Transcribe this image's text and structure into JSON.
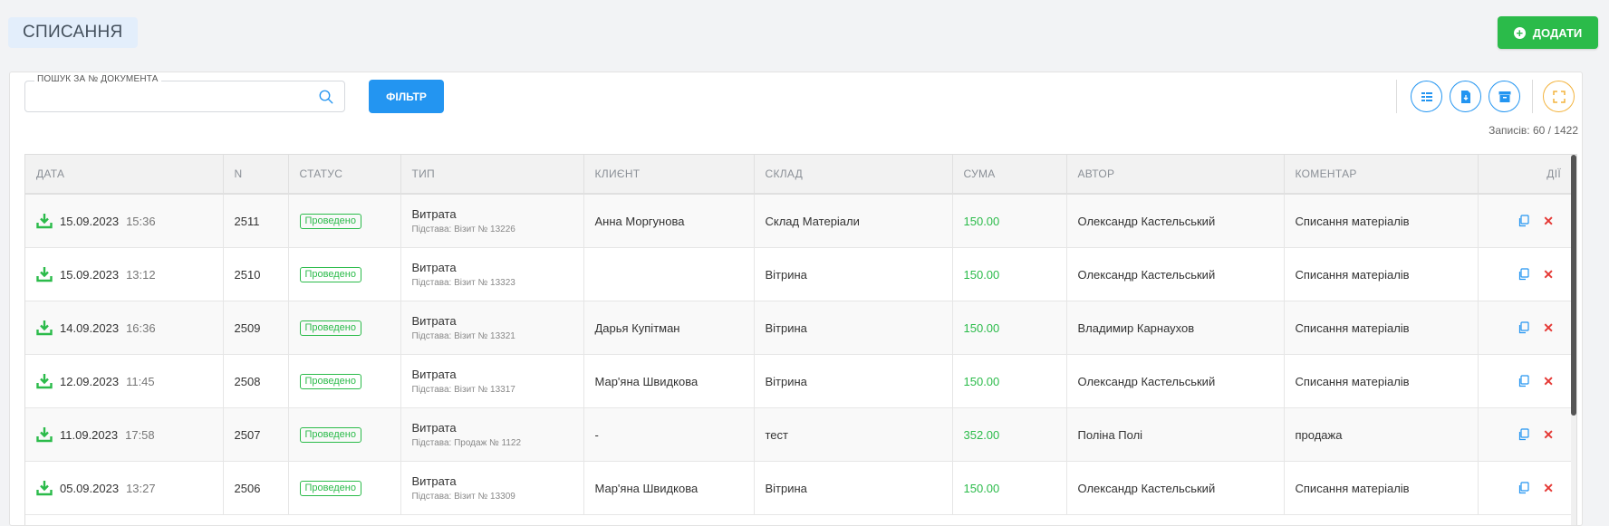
{
  "header": {
    "title": "СПИСАННЯ",
    "add_label": "ДОДАТИ"
  },
  "search": {
    "label": "ПОШУК ЗА № ДОКУМЕНТА",
    "value": ""
  },
  "filter_label": "ФІЛЬТР",
  "toolbar_icons": [
    "columns-icon",
    "export-icon",
    "archive-icon",
    "fullscreen-icon"
  ],
  "records_text": "Записів: 60 / 1422",
  "colors": {
    "accent": "#2395f1",
    "success": "#2bbb4a",
    "danger": "#e53935",
    "warning": "#f3b33d"
  },
  "table": {
    "headers": [
      "ДАТА",
      "N",
      "СТАТУС",
      "ТИП",
      "КЛИЄНТ",
      "СКЛАД",
      "СУМА",
      "АВТОР",
      "КОМЕНТАР",
      "ДІЇ"
    ],
    "rows": [
      {
        "date": "15.09.2023",
        "time": "15:36",
        "n": "2511",
        "status": "Проведено",
        "type": "Витрата",
        "basis": "Підстава: Візит № 13226",
        "client": "Анна Моргунова",
        "warehouse": "Склад Матеріали",
        "sum": "150.00",
        "author": "Олександр Кастельський",
        "comment": "Списання матеріалів"
      },
      {
        "date": "15.09.2023",
        "time": "13:12",
        "n": "2510",
        "status": "Проведено",
        "type": "Витрата",
        "basis": "Підстава: Візит № 13323",
        "client": "",
        "warehouse": "Вітрина",
        "sum": "150.00",
        "author": "Олександр Кастельський",
        "comment": "Списання матеріалів"
      },
      {
        "date": "14.09.2023",
        "time": "16:36",
        "n": "2509",
        "status": "Проведено",
        "type": "Витрата",
        "basis": "Підстава: Візит № 13321",
        "client": "Дарья Купітман",
        "warehouse": "Вітрина",
        "sum": "150.00",
        "author": "Владимир Карнаухов",
        "comment": "Списання матеріалів"
      },
      {
        "date": "12.09.2023",
        "time": "11:45",
        "n": "2508",
        "status": "Проведено",
        "type": "Витрата",
        "basis": "Підстава: Візит № 13317",
        "client": "Мар'яна Швидкова",
        "warehouse": "Вітрина",
        "sum": "150.00",
        "author": "Олександр Кастельський",
        "comment": "Списання матеріалів"
      },
      {
        "date": "11.09.2023",
        "time": "17:58",
        "n": "2507",
        "status": "Проведено",
        "type": "Витрата",
        "basis": "Підстава: Продаж № 1122",
        "client": "-",
        "warehouse": "тест",
        "sum": "352.00",
        "author": "Поліна Полі",
        "comment": "продажа"
      },
      {
        "date": "05.09.2023",
        "time": "13:27",
        "n": "2506",
        "status": "Проведено",
        "type": "Витрата",
        "basis": "Підстава: Візит № 13309",
        "client": "Мар'яна Швидкова",
        "warehouse": "Вітрина",
        "sum": "150.00",
        "author": "Олександр Кастельський",
        "comment": "Списання матеріалів"
      }
    ]
  }
}
